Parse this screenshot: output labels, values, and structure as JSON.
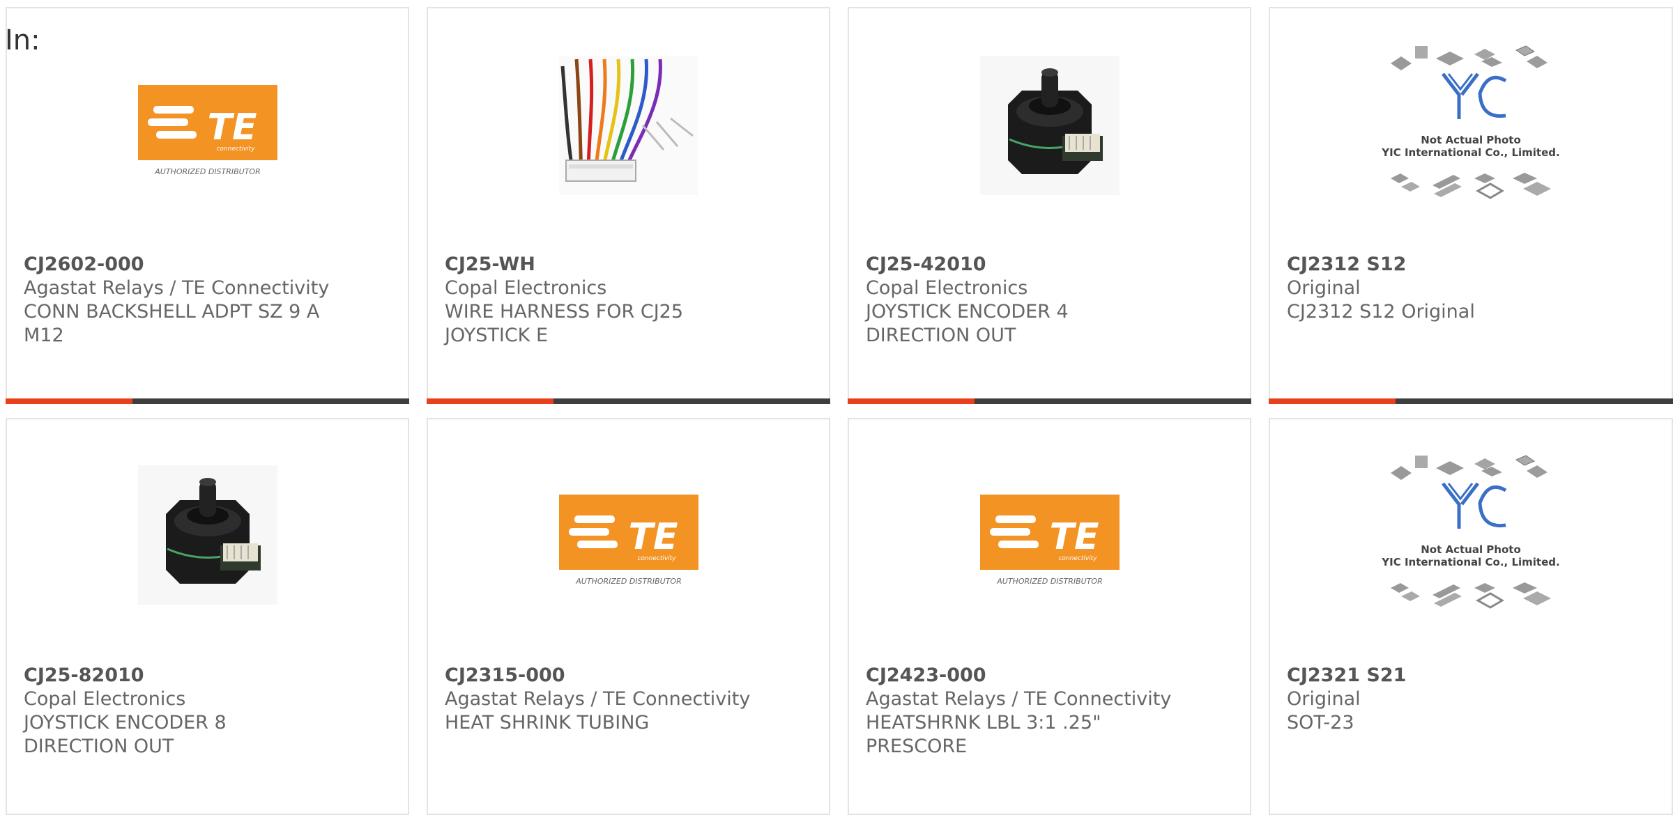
{
  "filter": {
    "label": "In:"
  },
  "colors": {
    "accent": "#e8401c",
    "bar": "#3e3e3e",
    "te_orange": "#f39324"
  },
  "cards": [
    {
      "part": "CJ2602-000",
      "lines": [
        "Agastat Relays / TE Connectivity",
        "CONN BACKSHELL ADPT SZ 9 A",
        "M12"
      ],
      "image": "te-logo",
      "logo_sub": "connectivity",
      "logo_caption": "AUTHORIZED DISTRIBUTOR"
    },
    {
      "part": "CJ25-WH",
      "lines": [
        "Copal Electronics",
        "WIRE HARNESS FOR CJ25",
        "JOYSTICK E"
      ],
      "image": "wire-harness"
    },
    {
      "part": "CJ25-42010",
      "lines": [
        "Copal Electronics",
        "JOYSTICK ENCODER 4",
        "DIRECTION OUT"
      ],
      "image": "joystick-encoder"
    },
    {
      "part": "CJ2312 S12",
      "lines": [
        "Original",
        "CJ2312 S12 Original"
      ],
      "image": "yic-placeholder",
      "note1": "Not Actual Photo",
      "note2": "YIC International Co., Limited."
    },
    {
      "part": "CJ25-82010",
      "lines": [
        "Copal Electronics",
        "JOYSTICK ENCODER 8",
        "DIRECTION OUT"
      ],
      "image": "joystick-encoder"
    },
    {
      "part": "CJ2315-000",
      "lines": [
        "Agastat Relays / TE Connectivity",
        "HEAT SHRINK TUBING"
      ],
      "image": "te-logo",
      "logo_sub": "connectivity",
      "logo_caption": "AUTHORIZED DISTRIBUTOR"
    },
    {
      "part": "CJ2423-000",
      "lines": [
        "Agastat Relays / TE Connectivity",
        "HEATSHRNK LBL 3:1 .25\"",
        "PRESCORE"
      ],
      "image": "te-logo",
      "logo_sub": "connectivity",
      "logo_caption": "AUTHORIZED DISTRIBUTOR"
    },
    {
      "part": "CJ2321 S21",
      "lines": [
        "Original",
        "SOT-23"
      ],
      "image": "yic-placeholder",
      "note1": "Not Actual Photo",
      "note2": "YIC International Co., Limited."
    }
  ]
}
